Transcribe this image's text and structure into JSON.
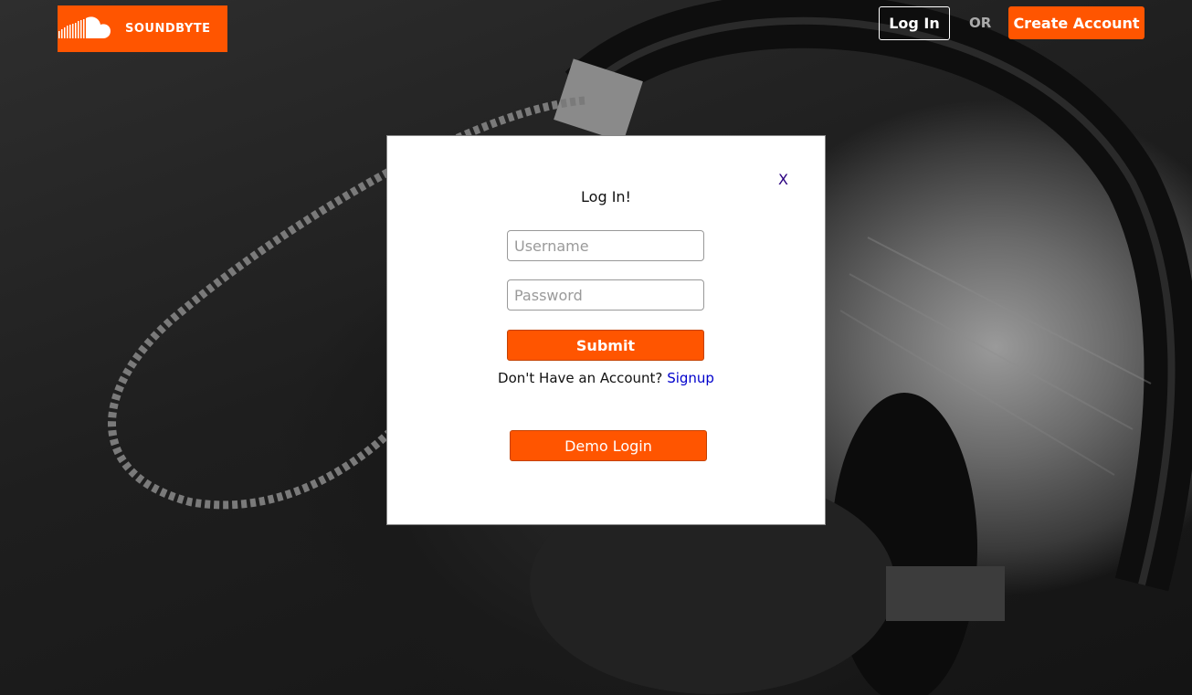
{
  "header": {
    "brand": "SOUNDBYTE",
    "login_label": "Log In",
    "or_label": "OR",
    "create_label": "Create Account"
  },
  "modal": {
    "close_label": "X",
    "title": "Log In!",
    "username_placeholder": "Username",
    "password_placeholder": "Password",
    "submit_label": "Submit",
    "signup_prompt": "Don't Have an Account?",
    "signup_link": "Signup",
    "demo_label": "Demo Login"
  },
  "colors": {
    "accent": "#ff5500",
    "link": "#0000cc"
  },
  "icons": {
    "logo": "soundcloud-cloud-icon"
  }
}
